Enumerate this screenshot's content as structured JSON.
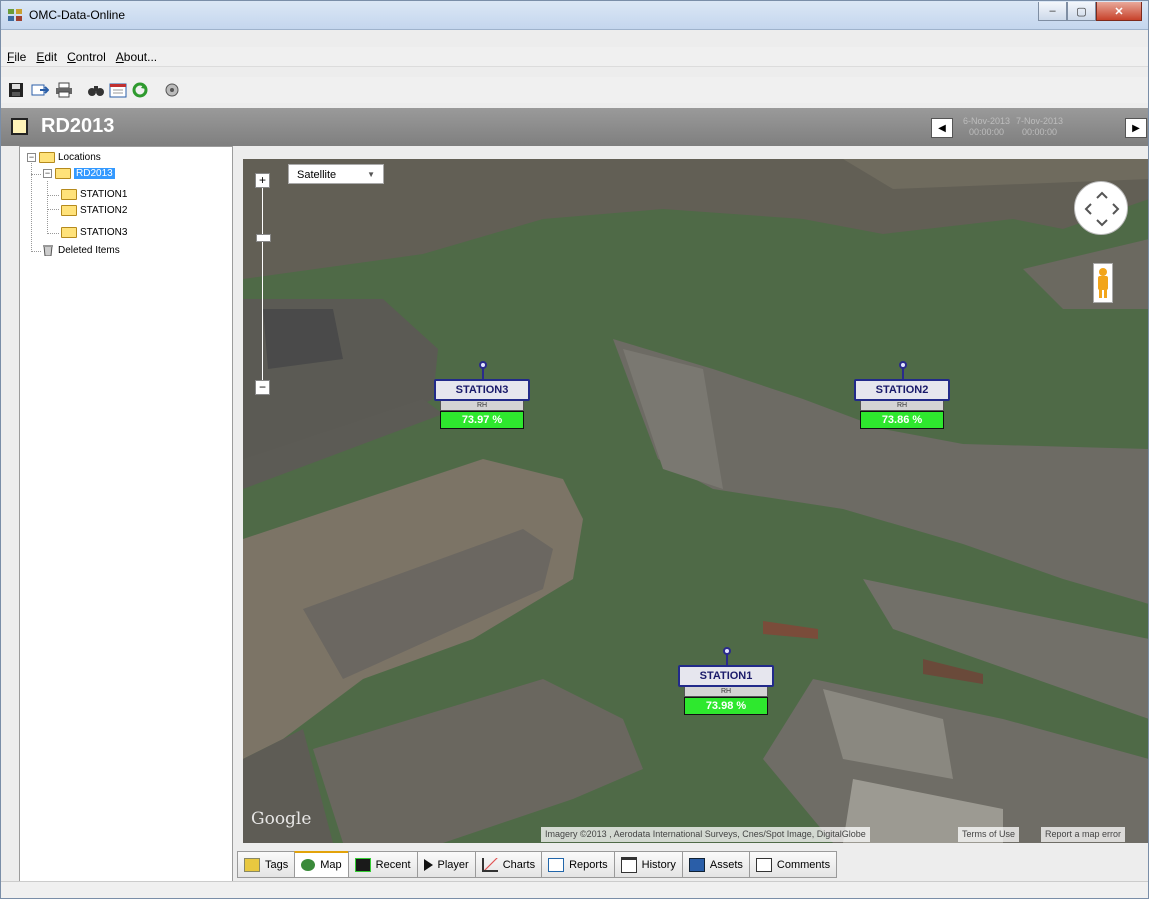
{
  "window": {
    "title": "OMC-Data-Online",
    "min": "–",
    "max": "▢",
    "close": "✕"
  },
  "menu": [
    "File",
    "Edit",
    "Control",
    "About..."
  ],
  "toolbar": [
    "save-icon",
    "export-icon",
    "print-icon",
    "find-icon",
    "calendar-icon",
    "refresh-icon",
    "settings-icon"
  ],
  "header": {
    "title": "RD2013",
    "start_date": "6-Nov-2013",
    "start_time": "00:00:00",
    "end_date": "7-Nov-2013",
    "end_time": "00:00:00",
    "prev": "◀",
    "next": "▶"
  },
  "tree": {
    "root": "Locations",
    "location": "RD2013",
    "stations": [
      "STATION1",
      "STATION2",
      "STATION3"
    ],
    "deleted": "Deleted Items"
  },
  "map": {
    "type_select": "Satellite",
    "zoom_in": "+",
    "zoom_out": "−",
    "google": "Google",
    "attribution": "Imagery ©2013 , Aerodata International Surveys, Cnes/Spot Image, DigitalGlobe",
    "terms": "Terms of Use",
    "report": "Report a map error",
    "stations": [
      {
        "name": "STATION3",
        "sub": "RH",
        "value": "73.97 %"
      },
      {
        "name": "STATION2",
        "sub": "RH",
        "value": "73.86 %"
      },
      {
        "name": "STATION1",
        "sub": "RH",
        "value": "73.98 %"
      }
    ]
  },
  "tabs": [
    "Tags",
    "Map",
    "Recent",
    "Player",
    "Charts",
    "Reports",
    "History",
    "Assets",
    "Comments"
  ],
  "colors": {
    "water": "#4f6a47",
    "station_value": "#2ee82e",
    "station_border": "#222a8a",
    "header": "#8a8a8a"
  }
}
